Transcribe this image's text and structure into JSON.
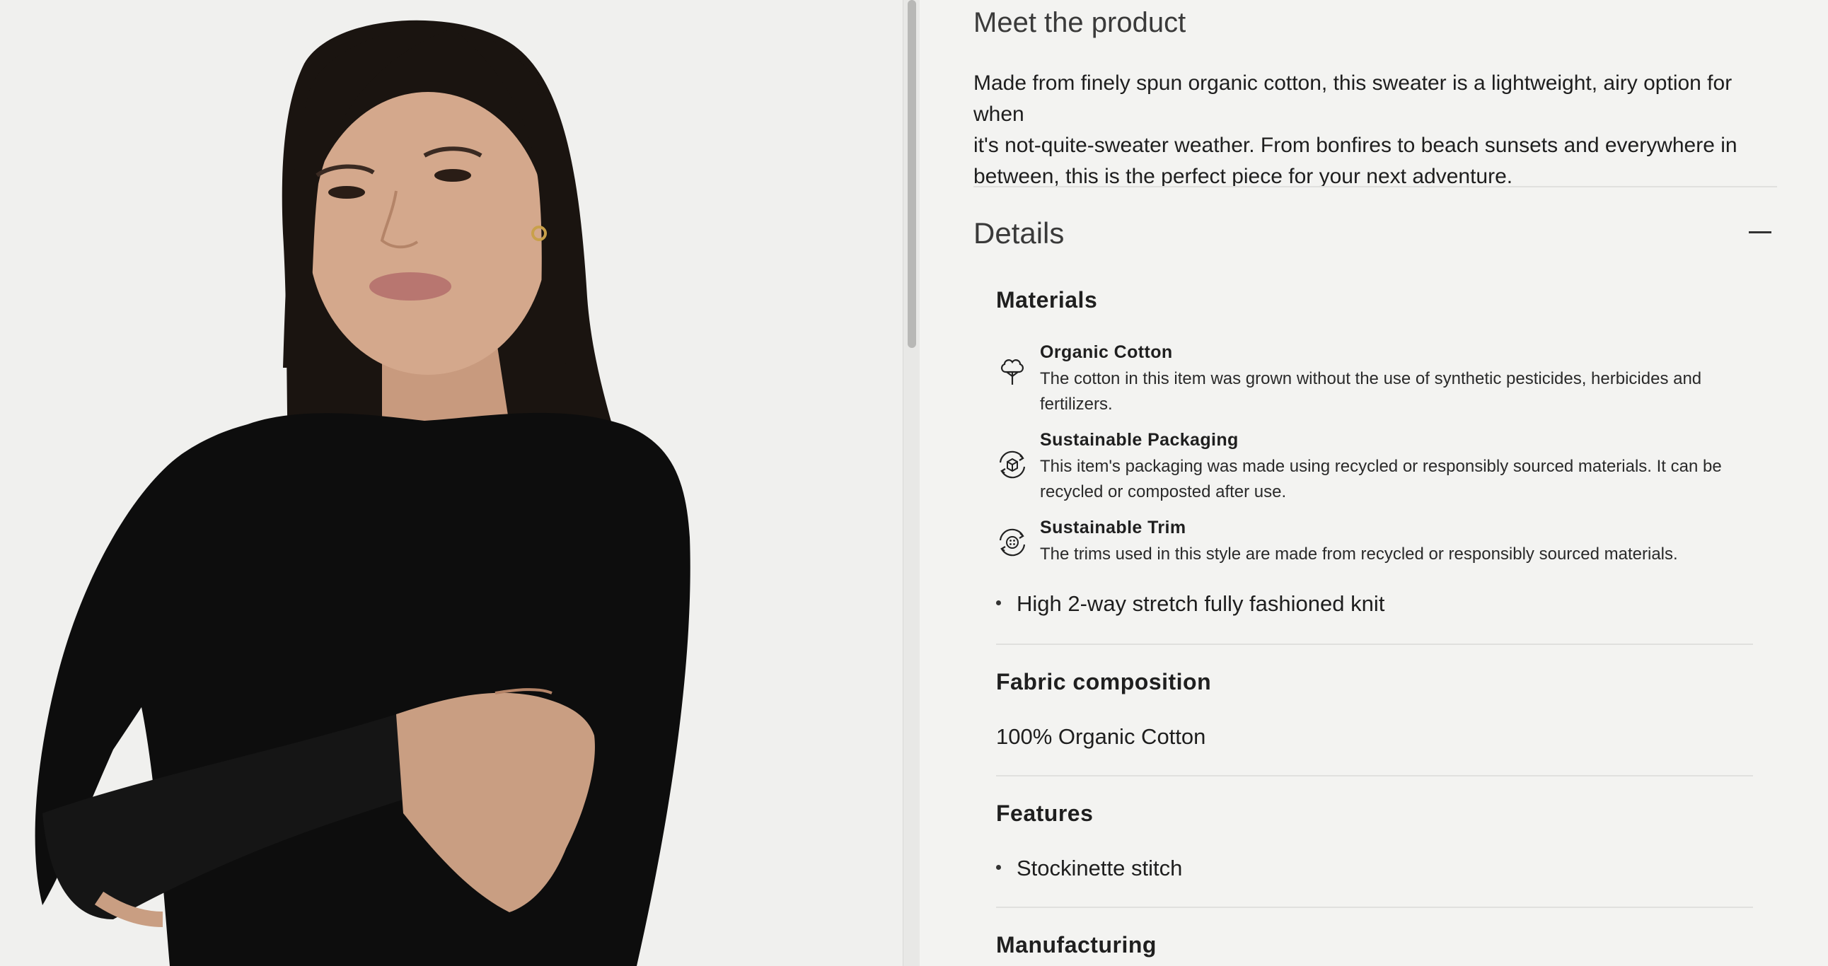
{
  "product_image": {
    "alt": "Model wearing black organic cotton sweater"
  },
  "description_section": {
    "title": "Meet the product",
    "lines": [
      "Made from finely spun organic cotton, this sweater is a lightweight, airy option for when",
      "it's not-quite-sweater weather. From bonfires to beach sunsets and everywhere in",
      "between, this is the perfect piece for your next adventure."
    ]
  },
  "details": {
    "title": "Details",
    "collapse_icon": "minus-icon",
    "materials": {
      "heading": "Materials",
      "items": [
        {
          "icon": "cotton-plant-icon",
          "name": "Organic Cotton",
          "desc_lines": [
            "The cotton in this item was grown without the use of synthetic pesticides, herbicides and",
            "fertilizers."
          ]
        },
        {
          "icon": "recycled-box-icon",
          "name": "Sustainable Packaging",
          "desc_lines": [
            "This item's packaging was made using recycled or responsibly sourced materials. It can be",
            "recycled or composted after use."
          ]
        },
        {
          "icon": "recycled-button-icon",
          "name": "Sustainable Trim",
          "desc_lines": [
            "The trims used in this style are made from recycled or responsibly sourced materials."
          ]
        }
      ],
      "bullets": [
        "High 2-way stretch fully fashioned knit"
      ]
    },
    "fabric_composition": {
      "heading": "Fabric composition",
      "value": "100% Organic Cotton"
    },
    "features": {
      "heading": "Features",
      "bullets": [
        "Stockinette stitch"
      ]
    },
    "manufacturing": {
      "heading": "Manufacturing"
    }
  }
}
